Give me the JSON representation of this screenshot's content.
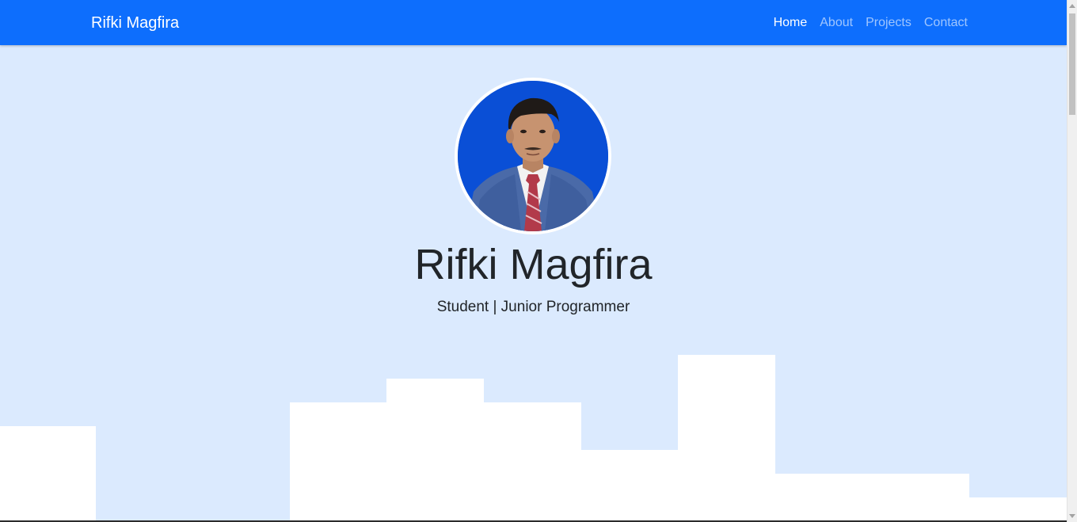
{
  "navbar": {
    "brand": "Rifki Magfira",
    "background": "#0d6efd",
    "links": [
      {
        "label": "Home",
        "active": true
      },
      {
        "label": "About",
        "active": false
      },
      {
        "label": "Projects",
        "active": false
      },
      {
        "label": "Contact",
        "active": false
      }
    ]
  },
  "hero": {
    "name": "Rifki Magfira",
    "tagline": "Student | Junior Programmer",
    "background": "#dbeafe",
    "avatar_icon": "profile-photo"
  }
}
